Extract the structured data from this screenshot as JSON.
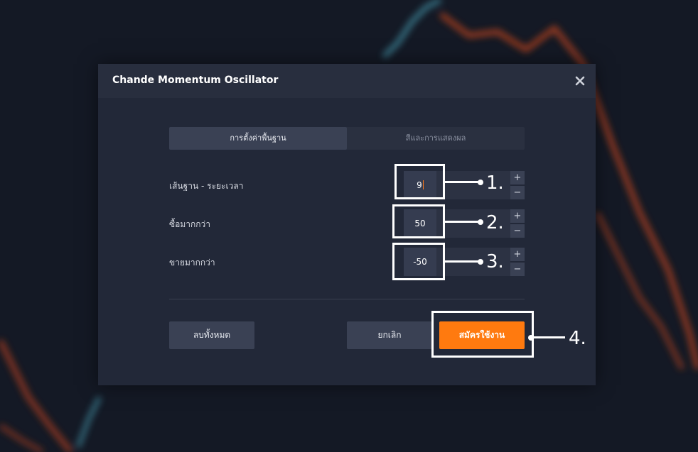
{
  "dialog": {
    "title": "Chande Momentum Oscillator",
    "close_icon": "close-icon"
  },
  "tabs": [
    {
      "label": "การตั้งค่าพื้นฐาน",
      "active": true
    },
    {
      "label": "สีและการแสดงผล",
      "active": false
    }
  ],
  "fields": [
    {
      "label": "เส้นฐาน - ระยะเวลา",
      "value": "9"
    },
    {
      "label": "ซื้อมากกว่า",
      "value": "50"
    },
    {
      "label": "ขายมากกว่า",
      "value": "-50"
    }
  ],
  "stepper": {
    "plus": "+",
    "minus": "−"
  },
  "buttons": {
    "reset": "ลบทั้งหมด",
    "cancel": "ยกเลิก",
    "apply": "สมัครใช้งาน"
  },
  "annotations": [
    "1.",
    "2.",
    "3.",
    "4."
  ],
  "colors": {
    "accent": "#ff7a0f",
    "dialog_bg": "#222838",
    "page_bg": "#141925"
  }
}
